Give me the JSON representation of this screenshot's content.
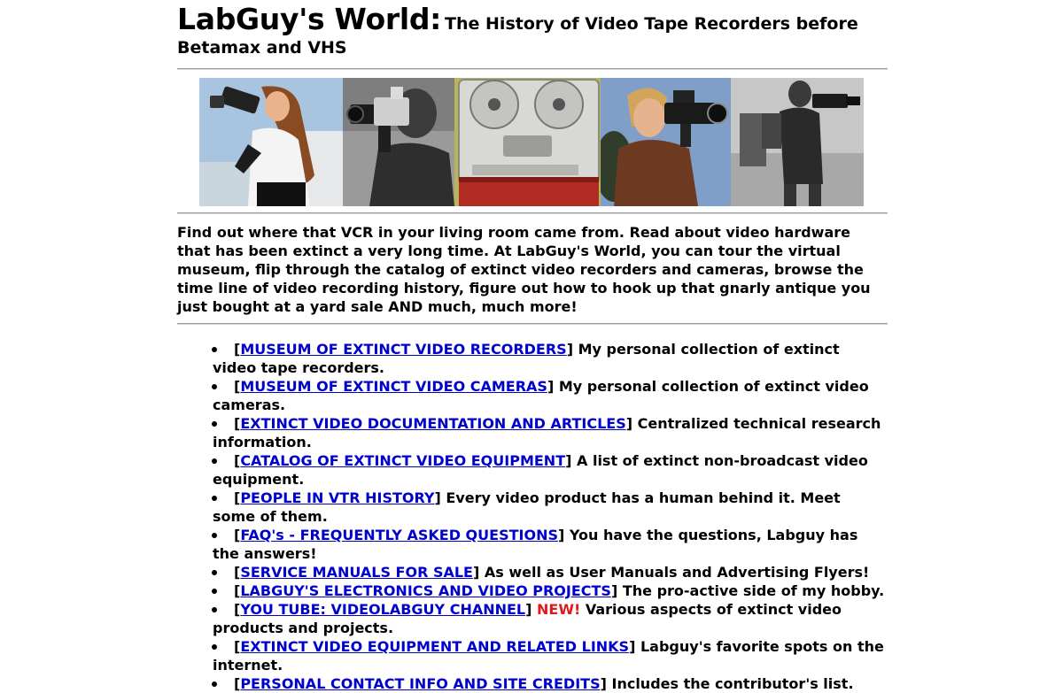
{
  "header": {
    "site_name": "LabGuy's World:",
    "subtitle": "The History of Video Tape Recorders before Betamax and VHS"
  },
  "banner": {
    "photos": [
      {
        "name": "woman-with-camera-photo"
      },
      {
        "name": "man-with-handheld-camera-photo"
      },
      {
        "name": "reel-to-reel-recorder-photo"
      },
      {
        "name": "boy-with-camera-photo"
      },
      {
        "name": "man-with-backpack-camera-photo"
      }
    ]
  },
  "intro": {
    "text": "Find out where that VCR in your living room came from. Read about video hardware that has been extinct a very long time. At LabGuy's World, you can tour the virtual museum, flip through the catalog of extinct video recorders and cameras, browse the time line of video recording history, figure out how to hook up that gnarly antique you just bought at a yard sale AND much, much more!"
  },
  "nav": {
    "items": [
      {
        "link": "MUSEUM OF EXTINCT VIDEO RECORDERS",
        "desc": "My personal collection of extinct video tape recorders."
      },
      {
        "link": "MUSEUM OF EXTINCT VIDEO CAMERAS",
        "desc": "My personal collection of extinct video cameras."
      },
      {
        "link": "EXTINCT VIDEO DOCUMENTATION AND ARTICLES",
        "desc": "Centralized technical research information."
      },
      {
        "link": "CATALOG OF EXTINCT VIDEO EQUIPMENT",
        "desc": "A list of extinct non-broadcast video equipment."
      },
      {
        "link": "PEOPLE IN VTR HISTORY",
        "desc": "Every video product has a human behind it. Meet some of them."
      },
      {
        "link": "FAQ's - FREQUENTLY ASKED QUESTIONS",
        "desc": "You have the questions, Labguy has the answers!"
      },
      {
        "link": "SERVICE MANUALS FOR SALE",
        "desc": "As well as User Manuals and Advertising Flyers!"
      },
      {
        "link": "LABGUY'S ELECTRONICS AND VIDEO PROJECTS",
        "desc": "The pro-active side of my hobby."
      },
      {
        "link": "YOU TUBE: VIDEOLABGUY CHANNEL",
        "badge": "NEW!",
        "desc": "Various aspects of extinct video products and projects."
      },
      {
        "link": "EXTINCT VIDEO EQUIPMENT AND RELATED LINKS",
        "desc": "Labguy's favorite spots on the internet."
      },
      {
        "link": "PERSONAL CONTACT INFO AND SITE CREDITS",
        "desc": "Includes the contributor's list."
      }
    ]
  },
  "colors": {
    "link": "#0000cc",
    "new_badge": "#e01a1a"
  }
}
